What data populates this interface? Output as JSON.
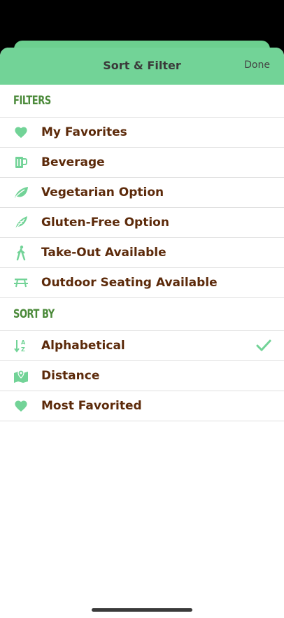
{
  "header": {
    "title": "Sort & Filter",
    "done_label": "Done"
  },
  "filters": {
    "heading": "FILTERS",
    "items": [
      {
        "label": "My Favorites",
        "icon": "heart-icon"
      },
      {
        "label": "Beverage",
        "icon": "mug-icon"
      },
      {
        "label": "Vegetarian Option",
        "icon": "leaf-icon"
      },
      {
        "label": "Gluten-Free Option",
        "icon": "feather-icon"
      },
      {
        "label": "Take-Out Available",
        "icon": "walking-icon"
      },
      {
        "label": "Outdoor Seating Available",
        "icon": "picnic-table-icon"
      }
    ]
  },
  "sort": {
    "heading": "SORT BY",
    "items": [
      {
        "label": "Alphabetical",
        "icon": "sort-az-icon",
        "selected": true
      },
      {
        "label": "Distance",
        "icon": "map-pin-icon",
        "selected": false
      },
      {
        "label": "Most Favorited",
        "icon": "heart-icon",
        "selected": false
      }
    ]
  },
  "colors": {
    "accent": "#72d397",
    "label": "#5c2a0a",
    "section_heading": "#4b8a3a"
  }
}
